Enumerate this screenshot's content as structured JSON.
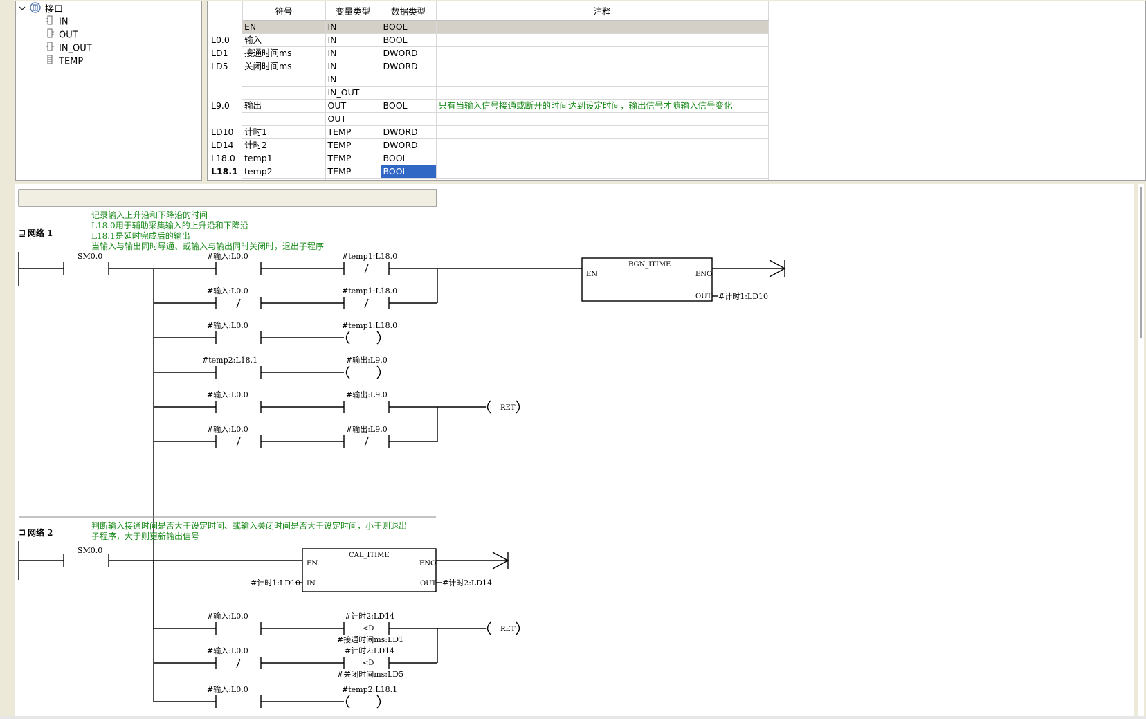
{
  "tree": {
    "root": "接口",
    "children": [
      "IN",
      "OUT",
      "IN_OUT",
      "TEMP"
    ]
  },
  "table": {
    "headers": [
      "符号",
      "变量类型",
      "数据类型",
      "注释"
    ],
    "rows": [
      {
        "addr": "",
        "sym": "EN",
        "vtype": "IN",
        "dtype": "BOOL",
        "comment": ""
      },
      {
        "addr": "L0.0",
        "sym": "输入",
        "vtype": "IN",
        "dtype": "BOOL",
        "comment": ""
      },
      {
        "addr": "LD1",
        "sym": "接通时间ms",
        "vtype": "IN",
        "dtype": "DWORD",
        "comment": ""
      },
      {
        "addr": "LD5",
        "sym": "关闭时间ms",
        "vtype": "IN",
        "dtype": "DWORD",
        "comment": ""
      },
      {
        "addr": "",
        "sym": "",
        "vtype": "IN",
        "dtype": "",
        "comment": ""
      },
      {
        "addr": "",
        "sym": "",
        "vtype": "IN_OUT",
        "dtype": "",
        "comment": ""
      },
      {
        "addr": "L9.0",
        "sym": "输出",
        "vtype": "OUT",
        "dtype": "BOOL",
        "comment": "只有当输入信号接通或断开的时间达到设定时间，输出信号才随输入信号变化"
      },
      {
        "addr": "",
        "sym": "",
        "vtype": "OUT",
        "dtype": "",
        "comment": ""
      },
      {
        "addr": "LD10",
        "sym": "计时1",
        "vtype": "TEMP",
        "dtype": "DWORD",
        "comment": ""
      },
      {
        "addr": "LD14",
        "sym": "计时2",
        "vtype": "TEMP",
        "dtype": "DWORD",
        "comment": ""
      },
      {
        "addr": "L18.0",
        "sym": "temp1",
        "vtype": "TEMP",
        "dtype": "BOOL",
        "comment": ""
      },
      {
        "addr": "L18.1",
        "sym": "temp2",
        "vtype": "TEMP",
        "dtype": "BOOL",
        "comment": ""
      },
      {
        "addr": "",
        "sym": "",
        "vtype": "TEMP",
        "dtype": "",
        "comment": ""
      }
    ]
  },
  "networks": {
    "n1": {
      "title": "网络 1",
      "comments": [
        "记录输入上升沿和下降沿的时间",
        "L18.0用于辅助采集输入的上升沿和下降沿",
        "L18.1是延时完成后的输出",
        "当输入与输出同时导通、或输入与输出同时关闭时，退出子程序"
      ],
      "sm": "SM0.0",
      "r1a": "#输入:L0.0",
      "r1b": "#temp1:L18.0",
      "r2a": "#输入:L0.0",
      "r2b": "#temp1:L18.0",
      "r3a": "#输入:L0.0",
      "r3b": "#temp1:L18.0",
      "r4a": "#temp2:L18.1",
      "r4b": "#输出:L9.0",
      "r5a": "#输入:L0.0",
      "r5b": "#输出:L9.0",
      "r6a": "#输入:L0.0",
      "r6b": "#输出:L9.0",
      "ret": "RET",
      "box": {
        "name": "BGN_ITIME",
        "en": "EN",
        "eno": "ENO",
        "out": "OUT",
        "out_var": "#计时1:LD10"
      }
    },
    "n2": {
      "title": "网络 2",
      "comments": [
        "判断输入接通时间是否大于设定时间、或输入关闭时间是否大于设定时间，小于则退出",
        "子程序，大于则更新输出信号"
      ],
      "sm": "SM0.0",
      "box": {
        "name": "CAL_ITIME",
        "en": "EN",
        "eno": "ENO",
        "in": "IN",
        "out": "OUT",
        "in_var": "#计时1:LD10",
        "out_var": "#计时2:LD14"
      },
      "r1a": "#输入:L0.0",
      "r1b": "#计时2:LD14",
      "r1op": "<D",
      "r1c": "#接通时间ms:LD1",
      "r2a": "#输入:L0.0",
      "r2b": "#计时2:LD14",
      "r2op": "<D",
      "r2c": "#关闭时间ms:LD5",
      "r3a": "#输入:L0.0",
      "r3b": "#temp2:L18.1",
      "ret": "RET"
    }
  },
  "colors": {
    "comment": "#1a8a1a",
    "selection": "#3168c6",
    "panel": "#ece9d8"
  }
}
